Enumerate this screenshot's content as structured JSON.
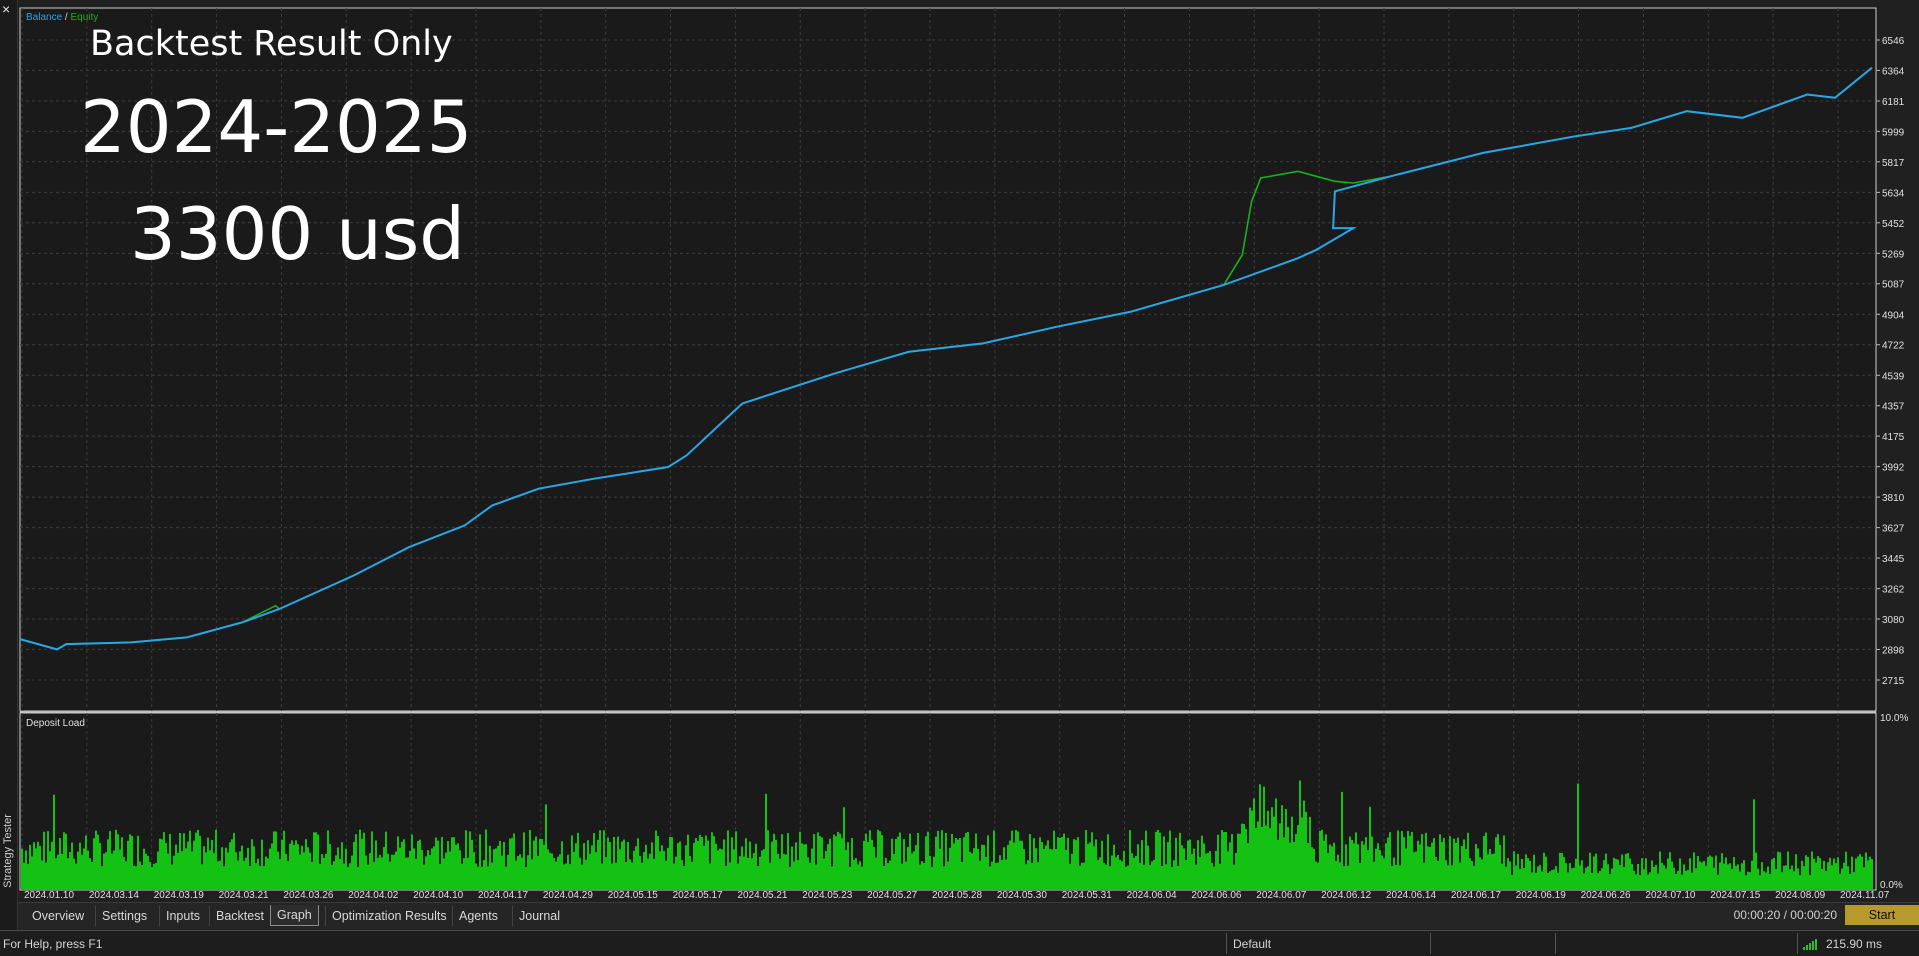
{
  "window": {
    "close_glyph": "×",
    "panel_label": "Strategy Tester"
  },
  "legend": {
    "balance": "Balance",
    "sep": " / ",
    "equity": "Equity",
    "deposit_load": "Deposit Load"
  },
  "overlay": {
    "title": "Backtest Result Only",
    "years": "2024-2025",
    "amount": "3300 usd"
  },
  "colors": {
    "balance": "#2aa5e6",
    "equity": "#19b01a",
    "deposit_bar": "#14c214",
    "grid": "#3c3c3c",
    "background": "#1a1a1a"
  },
  "y_ticks": [
    "6546",
    "6364",
    "6181",
    "5999",
    "5817",
    "5634",
    "5452",
    "5269",
    "5087",
    "4904",
    "4722",
    "4539",
    "4357",
    "4175",
    "3992",
    "3810",
    "3627",
    "3445",
    "3262",
    "3080",
    "2898",
    "2715"
  ],
  "load_ticks": [
    "10.0%",
    "0.0%"
  ],
  "x_labels": [
    "2024.01.10",
    "2024.03.14",
    "2024.03.19",
    "2024.03.21",
    "2024.03.26",
    "2024.04.02",
    "2024.04.10",
    "2024.04.17",
    "2024.04.29",
    "2024.05.15",
    "2024.05.17",
    "2024.05.21",
    "2024.05.23",
    "2024.05.27",
    "2024.05.28",
    "2024.05.30",
    "2024.05.31",
    "2024.06.04",
    "2024.06.06",
    "2024.06.07",
    "2024.06.12",
    "2024.06.14",
    "2024.06.17",
    "2024.06.19",
    "2024.06.26",
    "2024.07.10",
    "2024.07.15",
    "2024.08.09",
    "2024.11.07"
  ],
  "chart_data": [
    {
      "type": "line",
      "x_range": [
        0,
        100
      ],
      "ylim": [
        2715,
        6546
      ],
      "series": [
        {
          "name": "Balance",
          "points": [
            [
              0,
              2960
            ],
            [
              2,
              2898
            ],
            [
              2.5,
              2930
            ],
            [
              6,
              2940
            ],
            [
              9,
              2970
            ],
            [
              12,
              3060
            ],
            [
              14,
              3140
            ],
            [
              18,
              3340
            ],
            [
              21,
              3510
            ],
            [
              24,
              3640
            ],
            [
              25.5,
              3760
            ],
            [
              28,
              3860
            ],
            [
              31,
              3920
            ],
            [
              35,
              3990
            ],
            [
              36,
              4060
            ],
            [
              39,
              4370
            ],
            [
              44,
              4550
            ],
            [
              48,
              4680
            ],
            [
              52,
              4730
            ],
            [
              56,
              4830
            ],
            [
              60,
              4920
            ],
            [
              65,
              5080
            ],
            [
              69,
              5240
            ],
            [
              70,
              5290
            ],
            [
              72,
              5420
            ],
            [
              70.9,
              5420
            ],
            [
              71,
              5640
            ],
            [
              74,
              5730
            ],
            [
              79,
              5870
            ],
            [
              84,
              5970
            ],
            [
              87,
              6020
            ],
            [
              90,
              6120
            ],
            [
              93,
              6080
            ],
            [
              95,
              6160
            ],
            [
              96.5,
              6220
            ],
            [
              98,
              6200
            ],
            [
              100,
              6380
            ]
          ]
        },
        {
          "name": "Equity",
          "points": [
            [
              0,
              2960
            ],
            [
              2,
              2898
            ],
            [
              2.5,
              2930
            ],
            [
              6,
              2940
            ],
            [
              9,
              2970
            ],
            [
              12,
              3060
            ],
            [
              13.8,
              3160
            ],
            [
              14,
              3140
            ],
            [
              18,
              3340
            ],
            [
              21,
              3510
            ],
            [
              24,
              3640
            ],
            [
              25.5,
              3760
            ],
            [
              28,
              3860
            ],
            [
              31,
              3920
            ],
            [
              35,
              3990
            ],
            [
              36,
              4060
            ],
            [
              39,
              4370
            ],
            [
              44,
              4550
            ],
            [
              48,
              4680
            ],
            [
              52,
              4730
            ],
            [
              56,
              4830
            ],
            [
              60,
              4920
            ],
            [
              65,
              5080
            ],
            [
              66,
              5260
            ],
            [
              66.5,
              5580
            ],
            [
              67,
              5720
            ],
            [
              69,
              5760
            ],
            [
              71,
              5700
            ],
            [
              72,
              5690
            ],
            [
              74,
              5730
            ],
            [
              79,
              5870
            ],
            [
              84,
              5970
            ],
            [
              87,
              6020
            ],
            [
              90,
              6120
            ],
            [
              93,
              6080
            ],
            [
              95,
              6160
            ],
            [
              96.5,
              6220
            ],
            [
              98,
              6200
            ],
            [
              100,
              6380
            ]
          ]
        }
      ]
    },
    {
      "type": "bar",
      "name": "Deposit Load",
      "ylim": [
        0,
        10
      ],
      "unit": "%",
      "typical_level": 2.5,
      "peak_level": 5.8
    }
  ],
  "tabs": [
    "Overview",
    "Settings",
    "Inputs",
    "Backtest",
    "Graph",
    "Optimization Results",
    "Agents",
    "Journal"
  ],
  "active_tab": "Graph",
  "timer": "00:00:20 / 00:00:20",
  "start_label": "Start",
  "status": {
    "help": "For Help, press F1",
    "profile": "Default",
    "ping": "215.90 ms"
  }
}
